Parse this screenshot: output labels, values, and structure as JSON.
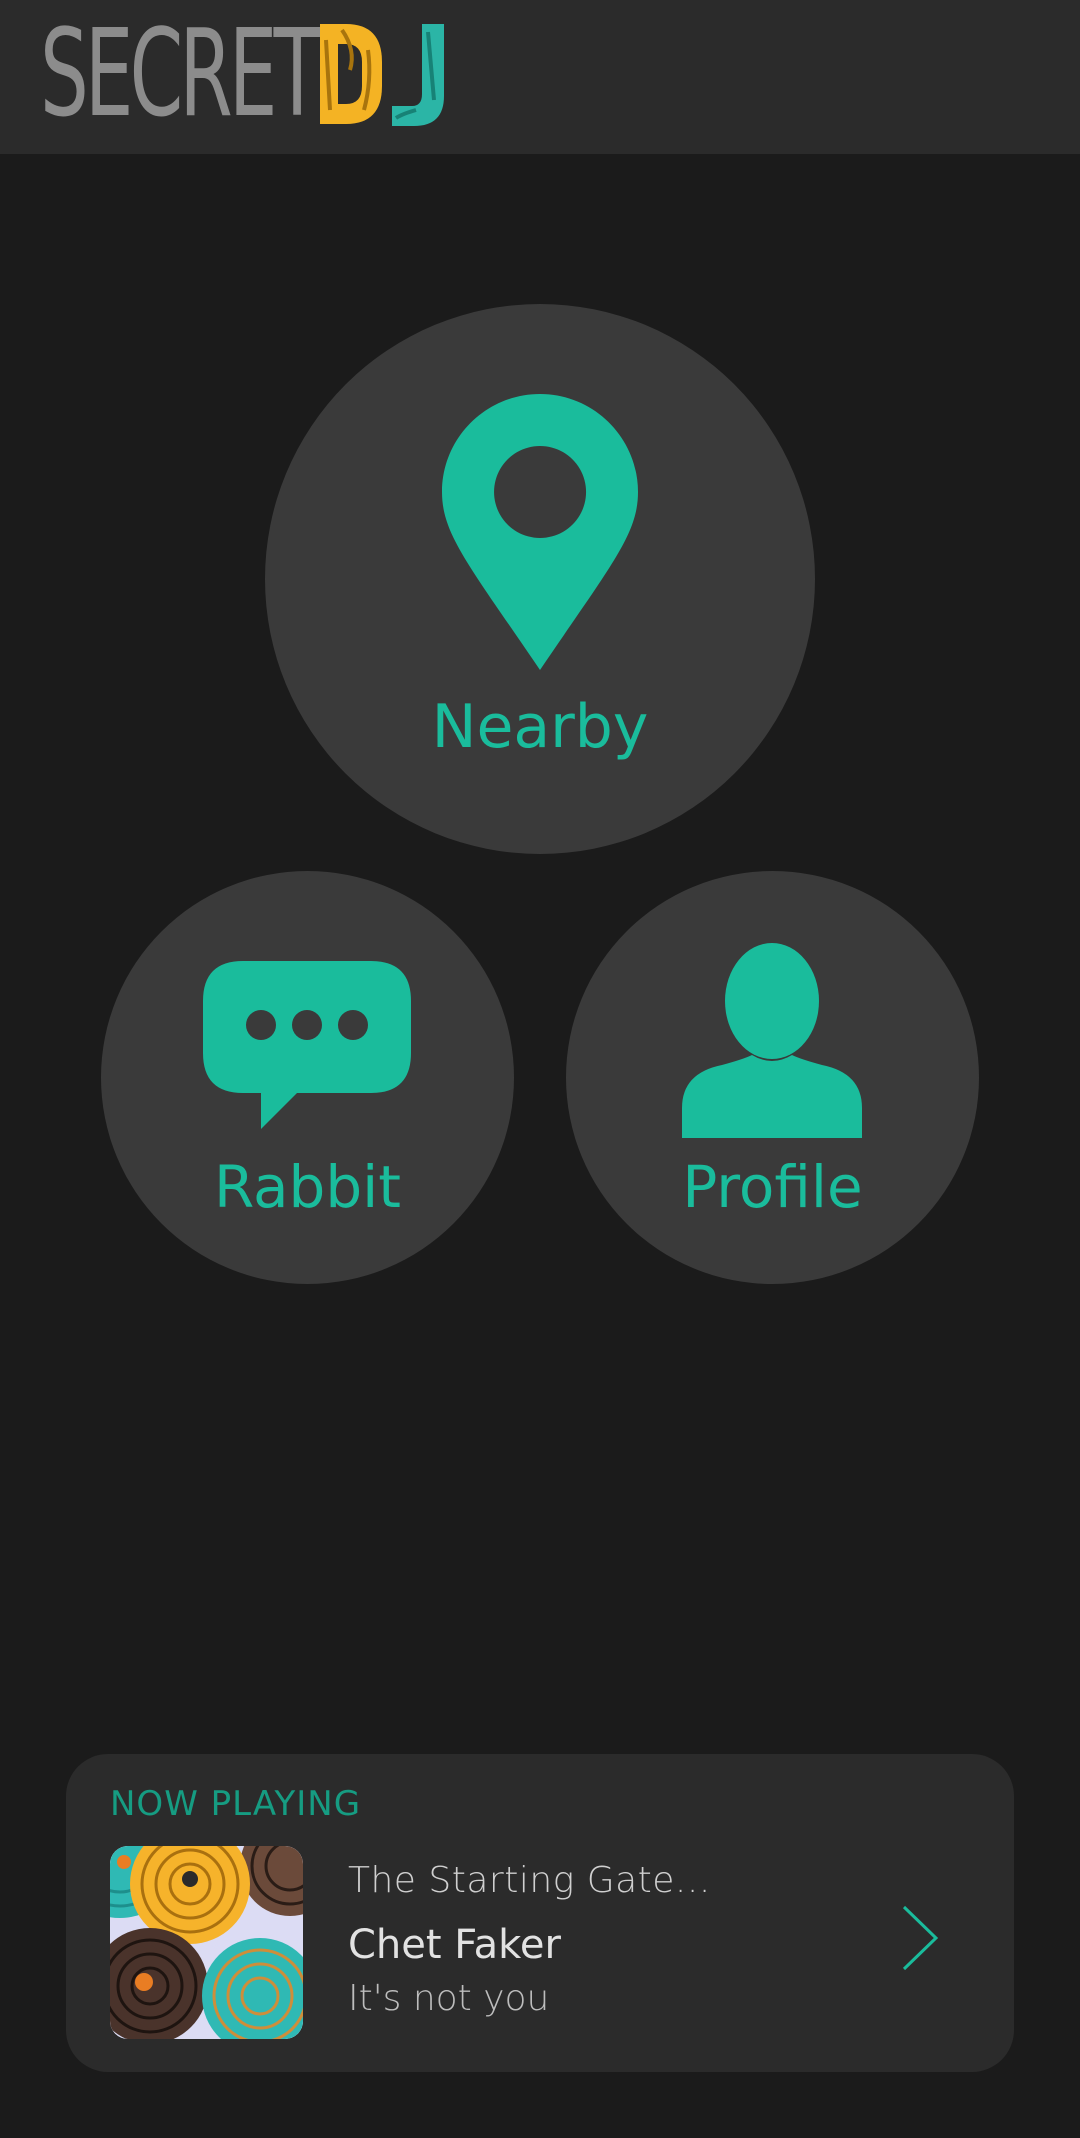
{
  "header": {
    "logo_text_secret": "SECRET",
    "logo_text_dj": "DJ",
    "logo_dj_colors": [
      "#f4b324",
      "#2bb5a6"
    ]
  },
  "menu": {
    "accent_color": "#1abc9c",
    "items": [
      {
        "label": "Nearby",
        "icon": "map-pin-icon"
      },
      {
        "label": "Rabbit",
        "icon": "chat-bubble-icon"
      },
      {
        "label": "Profile",
        "icon": "user-icon"
      }
    ]
  },
  "now_playing": {
    "heading": "NOW PLAYING",
    "track": "The Starting Gate...",
    "artist": "Chet Faker",
    "album": "It's not you",
    "chevron_icon": "chevron-right-icon",
    "art_icon": "album-art-vinyl-records"
  }
}
